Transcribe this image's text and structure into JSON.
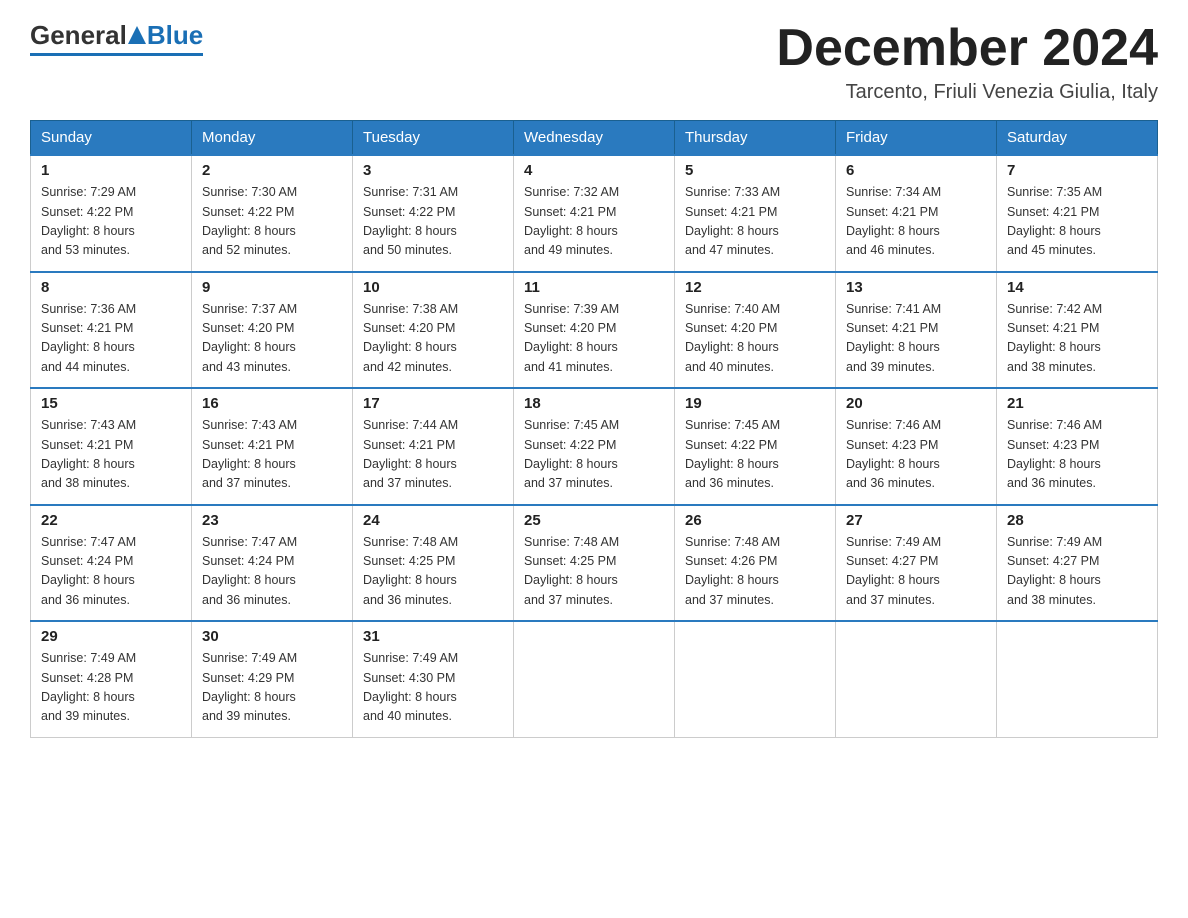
{
  "header": {
    "logo_general": "General",
    "logo_blue": "Blue",
    "month_title": "December 2024",
    "location": "Tarcento, Friuli Venezia Giulia, Italy"
  },
  "days_of_week": [
    "Sunday",
    "Monday",
    "Tuesday",
    "Wednesday",
    "Thursday",
    "Friday",
    "Saturday"
  ],
  "weeks": [
    [
      {
        "day": "1",
        "sunrise": "7:29 AM",
        "sunset": "4:22 PM",
        "daylight": "8 hours and 53 minutes."
      },
      {
        "day": "2",
        "sunrise": "7:30 AM",
        "sunset": "4:22 PM",
        "daylight": "8 hours and 52 minutes."
      },
      {
        "day": "3",
        "sunrise": "7:31 AM",
        "sunset": "4:22 PM",
        "daylight": "8 hours and 50 minutes."
      },
      {
        "day": "4",
        "sunrise": "7:32 AM",
        "sunset": "4:21 PM",
        "daylight": "8 hours and 49 minutes."
      },
      {
        "day": "5",
        "sunrise": "7:33 AM",
        "sunset": "4:21 PM",
        "daylight": "8 hours and 47 minutes."
      },
      {
        "day": "6",
        "sunrise": "7:34 AM",
        "sunset": "4:21 PM",
        "daylight": "8 hours and 46 minutes."
      },
      {
        "day": "7",
        "sunrise": "7:35 AM",
        "sunset": "4:21 PM",
        "daylight": "8 hours and 45 minutes."
      }
    ],
    [
      {
        "day": "8",
        "sunrise": "7:36 AM",
        "sunset": "4:21 PM",
        "daylight": "8 hours and 44 minutes."
      },
      {
        "day": "9",
        "sunrise": "7:37 AM",
        "sunset": "4:20 PM",
        "daylight": "8 hours and 43 minutes."
      },
      {
        "day": "10",
        "sunrise": "7:38 AM",
        "sunset": "4:20 PM",
        "daylight": "8 hours and 42 minutes."
      },
      {
        "day": "11",
        "sunrise": "7:39 AM",
        "sunset": "4:20 PM",
        "daylight": "8 hours and 41 minutes."
      },
      {
        "day": "12",
        "sunrise": "7:40 AM",
        "sunset": "4:20 PM",
        "daylight": "8 hours and 40 minutes."
      },
      {
        "day": "13",
        "sunrise": "7:41 AM",
        "sunset": "4:21 PM",
        "daylight": "8 hours and 39 minutes."
      },
      {
        "day": "14",
        "sunrise": "7:42 AM",
        "sunset": "4:21 PM",
        "daylight": "8 hours and 38 minutes."
      }
    ],
    [
      {
        "day": "15",
        "sunrise": "7:43 AM",
        "sunset": "4:21 PM",
        "daylight": "8 hours and 38 minutes."
      },
      {
        "day": "16",
        "sunrise": "7:43 AM",
        "sunset": "4:21 PM",
        "daylight": "8 hours and 37 minutes."
      },
      {
        "day": "17",
        "sunrise": "7:44 AM",
        "sunset": "4:21 PM",
        "daylight": "8 hours and 37 minutes."
      },
      {
        "day": "18",
        "sunrise": "7:45 AM",
        "sunset": "4:22 PM",
        "daylight": "8 hours and 37 minutes."
      },
      {
        "day": "19",
        "sunrise": "7:45 AM",
        "sunset": "4:22 PM",
        "daylight": "8 hours and 36 minutes."
      },
      {
        "day": "20",
        "sunrise": "7:46 AM",
        "sunset": "4:23 PM",
        "daylight": "8 hours and 36 minutes."
      },
      {
        "day": "21",
        "sunrise": "7:46 AM",
        "sunset": "4:23 PM",
        "daylight": "8 hours and 36 minutes."
      }
    ],
    [
      {
        "day": "22",
        "sunrise": "7:47 AM",
        "sunset": "4:24 PM",
        "daylight": "8 hours and 36 minutes."
      },
      {
        "day": "23",
        "sunrise": "7:47 AM",
        "sunset": "4:24 PM",
        "daylight": "8 hours and 36 minutes."
      },
      {
        "day": "24",
        "sunrise": "7:48 AM",
        "sunset": "4:25 PM",
        "daylight": "8 hours and 36 minutes."
      },
      {
        "day": "25",
        "sunrise": "7:48 AM",
        "sunset": "4:25 PM",
        "daylight": "8 hours and 37 minutes."
      },
      {
        "day": "26",
        "sunrise": "7:48 AM",
        "sunset": "4:26 PM",
        "daylight": "8 hours and 37 minutes."
      },
      {
        "day": "27",
        "sunrise": "7:49 AM",
        "sunset": "4:27 PM",
        "daylight": "8 hours and 37 minutes."
      },
      {
        "day": "28",
        "sunrise": "7:49 AM",
        "sunset": "4:27 PM",
        "daylight": "8 hours and 38 minutes."
      }
    ],
    [
      {
        "day": "29",
        "sunrise": "7:49 AM",
        "sunset": "4:28 PM",
        "daylight": "8 hours and 39 minutes."
      },
      {
        "day": "30",
        "sunrise": "7:49 AM",
        "sunset": "4:29 PM",
        "daylight": "8 hours and 39 minutes."
      },
      {
        "day": "31",
        "sunrise": "7:49 AM",
        "sunset": "4:30 PM",
        "daylight": "8 hours and 40 minutes."
      },
      null,
      null,
      null,
      null
    ]
  ],
  "labels": {
    "sunrise": "Sunrise:",
    "sunset": "Sunset:",
    "daylight": "Daylight:"
  }
}
